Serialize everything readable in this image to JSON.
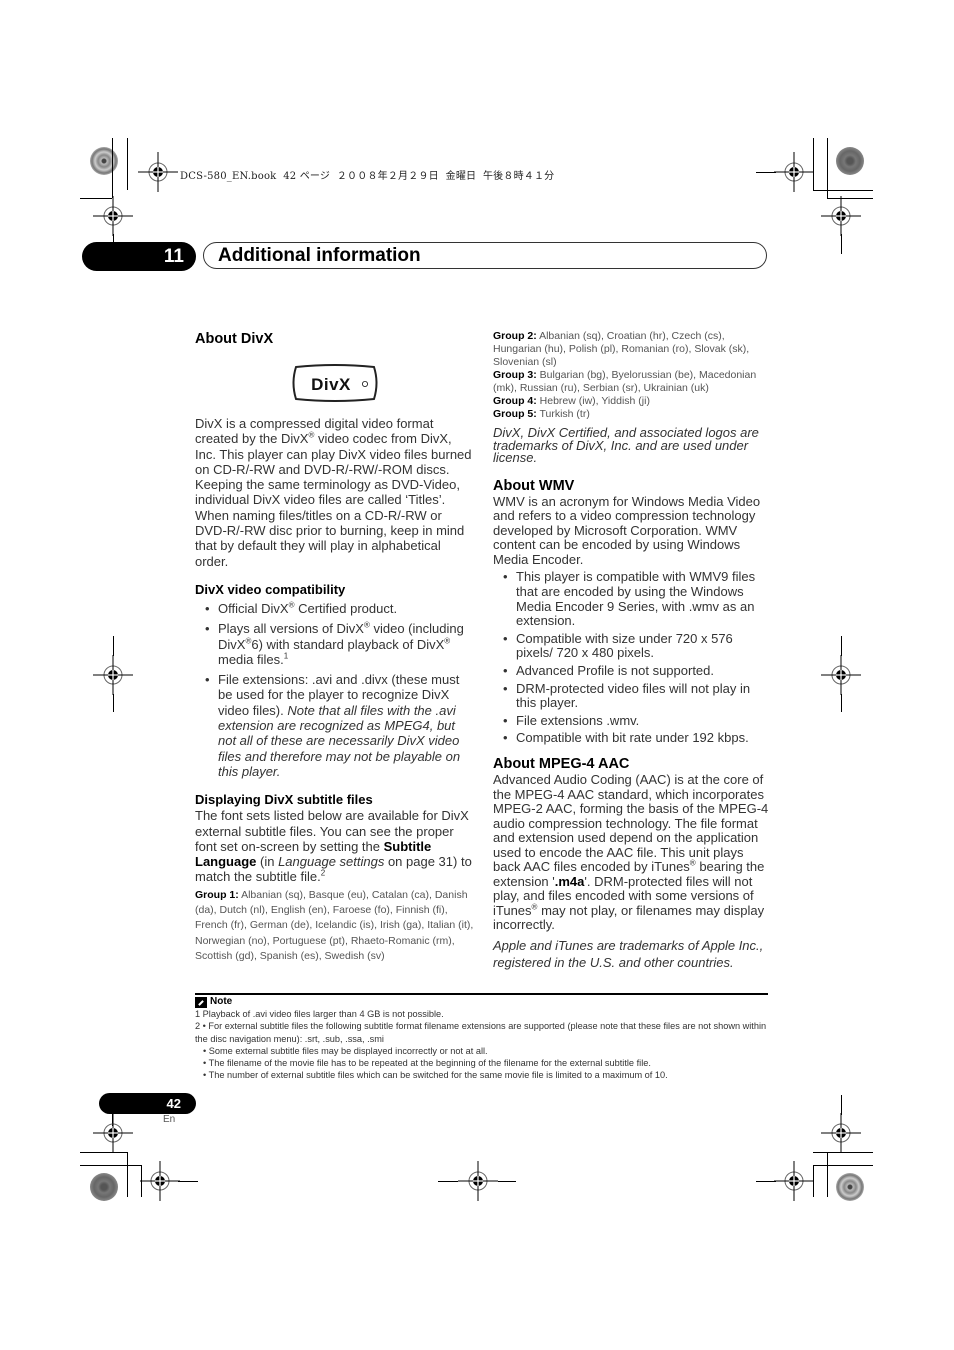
{
  "print_header": {
    "meta": "DCS-580_EN.book  42 ページ  ２００８年２月２９日  金曜日  午後８時４１分"
  },
  "chapter": {
    "number": "11",
    "title": "Additional information"
  },
  "about_divx": {
    "heading": "About DivX",
    "logo_text": "DivX",
    "paragraph_parts": [
      "DivX is a compressed digital video format created by the DivX",
      "®",
      " video codec from DivX, Inc. This player can play DivX video files burned on CD-R/-RW and DVD-R/-RW/-ROM discs. Keeping the same terminology as DVD-Video, individual DivX video files are called ‘Titles’. When naming files/titles on a CD-R/-RW or DVD-R/-RW disc prior to burning, keep in mind that by default they will play in alphabetical order."
    ],
    "compat": {
      "heading": "DivX video compatibility",
      "item1": {
        "a": "Official DivX",
        "reg": "®",
        "b": " Certified product."
      },
      "item2": {
        "a": "Plays all versions of DivX",
        "reg1": "®",
        "b": " video (including DivX",
        "reg2": "®",
        "c": "6) with standard playback of DivX",
        "reg3": "®",
        "d": " media files.",
        "footnote": "1"
      },
      "item3": {
        "a": "File extensions: .avi and .divx (these must be used for the player to recognize DivX video files). ",
        "italic": "Note that all files with the .avi extension are recognized as MPEG4, but not all of these are necessarily DivX video files and therefore may not be playable on this player."
      }
    },
    "subtitles": {
      "heading": "Displaying DivX subtitle files",
      "p_a": "The font sets listed below are available for DivX external subtitle files. You can see the proper font set on-screen by setting the ",
      "p_bold": "Subtitle Language",
      "p_b": " (in ",
      "p_italic": "Language settings",
      "p_c": " on page 31) to match the subtitle file.",
      "p_footnote": "2",
      "groups": [
        {
          "label": "Group 1:",
          "text": " Albanian (sq), Basque (eu), Catalan (ca), Danish (da), Dutch (nl), English (en), Faroese (fo), Finnish (fi), French (fr), German (de), Icelandic (is), Irish (ga), Italian (it), Norwegian (no), Portuguese (pt), Rhaeto-Romanic (rm), Scottish (gd), Spanish (es), Swedish (sv)"
        },
        {
          "label": "Group 2:",
          "text": " Albanian (sq), Croatian (hr), Czech (cs), Hungarian (hu), Polish (pl), Romanian (ro), Slovak (sk), Slovenian (sl)"
        },
        {
          "label": "Group 3:",
          "text": " Bulgarian (bg), Byelorussian (be), Macedonian (mk), Russian (ru), Serbian (sr), Ukrainian (uk)"
        },
        {
          "label": "Group 4:",
          "text": " Hebrew (iw), Yiddish (ji)"
        },
        {
          "label": "Group 5:",
          "text": " Turkish (tr)"
        }
      ],
      "trademark": "DivX, DivX Certified, and associated logos are trademarks of DivX, Inc. and are used under license."
    }
  },
  "about_wmv": {
    "heading": "About WMV",
    "paragraph": "WMV is an acronym for Windows Media Video and refers to a video compression technology developed by Microsoft Corporation. WMV content can be encoded by using Windows Media Encoder.",
    "bullets": [
      "This player is compatible with WMV9 files that are encoded by using the Windows Media Encoder 9 Series, with .wmv as an extension.",
      "Compatible with size under 720 x 576 pixels/ 720 x 480 pixels.",
      "Advanced Profile is not supported.",
      "DRM-protected video files will not play in this player.",
      "File extensions .wmv.",
      "Compatible with bit rate under 192 kbps."
    ]
  },
  "about_aac": {
    "heading": "About MPEG-4 AAC",
    "p_a": "Advanced Audio Coding (AAC) is at the core of the MPEG-4 AAC standard, which incorporates MPEG-2 AAC, forming the basis of the MPEG-4 audio compression technology. The file format and extension used depend on the application used to encode the AAC file. This unit plays back AAC files encoded by iTunes",
    "reg": "®",
    "p_b": " bearing the extension '",
    "p_bold": ".m4a",
    "p_c": "'. DRM-protected files will not play, and files encoded with some versions of iTunes",
    "p_d": " may not play, or filenames may display incorrectly.",
    "trademark": "Apple and iTunes are trademarks of Apple Inc., registered in the U.S. and other countries."
  },
  "notes": {
    "heading": "Note",
    "items": [
      "1 Playback of .avi video files larger than 4 GB is not possible.",
      "2 • For external subtitle files the following subtitle format filename extensions are supported (please note that these files are not shown within the disc navigation menu): .srt, .sub, .ssa, .smi"
    ],
    "sub_items": [
      "• Some external subtitle files may be displayed incorrectly or not at all.",
      "• The filename of the movie file has to be repeated at the beginning of the filename for the external subtitle file.",
      "• The number of external subtitle files which can be switched for the same movie file is limited to a maximum of 10."
    ]
  },
  "footer": {
    "page_number": "42",
    "language": "En"
  }
}
